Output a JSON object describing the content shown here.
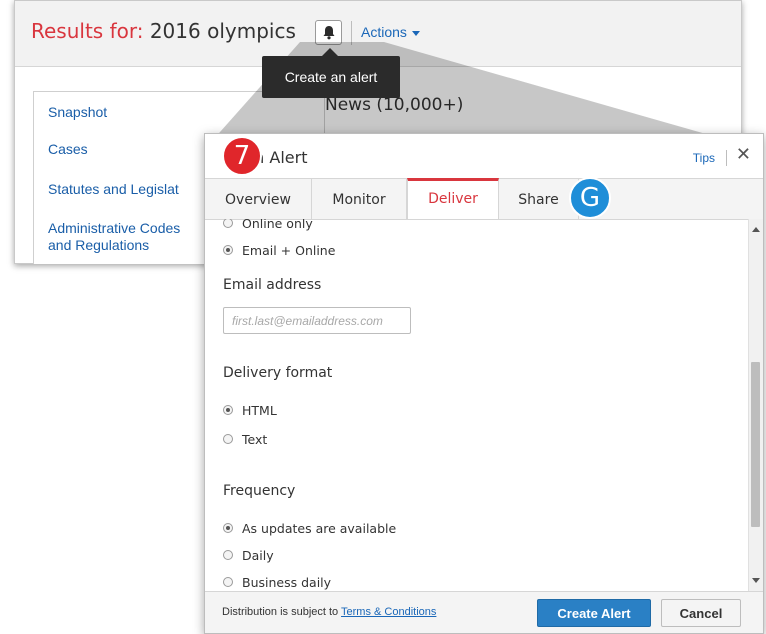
{
  "results": {
    "label": "Results for:",
    "query": "2016 olympics",
    "actions_label": "Actions",
    "side_nav": [
      "Snapshot",
      "Cases",
      "Statutes and Legislat",
      "Administrative Codes\nand Regulations"
    ],
    "news_title": "News (10,000+)"
  },
  "tooltip": {
    "text": "Create an alert"
  },
  "dialog": {
    "title_suffix": "n Alert",
    "title_prefix": "S",
    "tips_label": "Tips",
    "close_glyph": "✕",
    "tabs": [
      {
        "label": "Overview",
        "active": false
      },
      {
        "label": "Monitor",
        "active": false
      },
      {
        "label": "Deliver",
        "active": true
      },
      {
        "label": "Share",
        "active": false
      }
    ],
    "delivery_options": [
      {
        "label": "Online only",
        "checked": false
      },
      {
        "label": "Email + Online",
        "checked": true
      }
    ],
    "email_label": "Email address",
    "email_placeholder": "first.last@emailaddress.com",
    "email_value": "",
    "format_label": "Delivery format",
    "format_options": [
      {
        "label": "HTML",
        "checked": true
      },
      {
        "label": "Text",
        "checked": false
      }
    ],
    "frequency_label": "Frequency",
    "frequency_options": [
      {
        "label": "As updates are available",
        "checked": true
      },
      {
        "label": "Daily",
        "checked": false
      },
      {
        "label": "Business daily",
        "checked": false
      }
    ],
    "footer_text": "Distribution is subject to",
    "footer_link": "Terms & Conditions",
    "create_label": "Create Alert",
    "cancel_label": "Cancel"
  },
  "callouts": {
    "step": "7",
    "letter": "G"
  },
  "colors": {
    "accent_red": "#d9363e",
    "link_blue": "#1a67b8",
    "primary_button": "#2a80c5",
    "step_badge": "#e0262b",
    "letter_badge": "#1f8ed8"
  },
  "icons": {
    "alert": "bell-icon",
    "close": "close-icon",
    "dropdown": "caret-down-icon"
  }
}
